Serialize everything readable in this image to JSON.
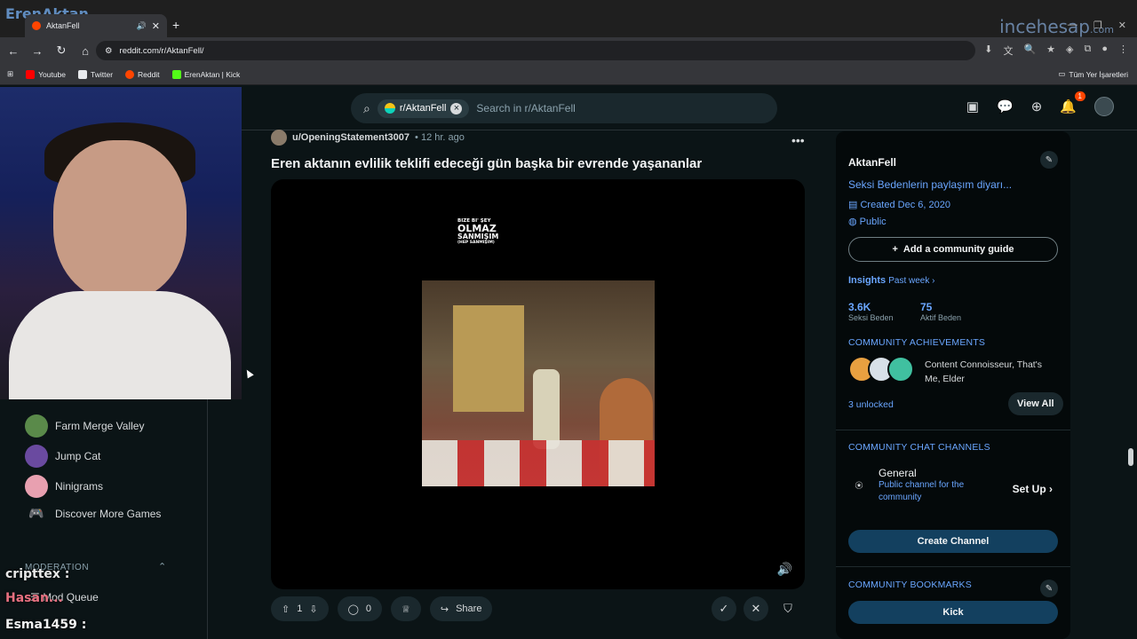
{
  "browser": {
    "tab_title": "AktanFell",
    "url": "reddit.com/r/AktanFell/",
    "brand_logo_text": "ErenAktan",
    "watermark": "incehesap",
    "watermark_suffix": ".com",
    "bookmarks": [
      {
        "label": "Youtube",
        "color": "#ff0000"
      },
      {
        "label": "Twitter",
        "color": "#e8eaed"
      },
      {
        "label": "Reddit",
        "color": "#ff4500"
      },
      {
        "label": "ErenAktan | Kick",
        "color": "#53fc18"
      }
    ],
    "bookmarks_folder": "Tüm Yer İşaretleri"
  },
  "header": {
    "subreddit_chip": "r/AktanFell",
    "search_placeholder": "Search in r/AktanFell",
    "notification_count": "1"
  },
  "left_sidebar": {
    "games": [
      {
        "label": "Farm Merge Valley",
        "color": "#5a8a4a"
      },
      {
        "label": "Jump Cat",
        "color": "#6a4aa0"
      },
      {
        "label": "Ninigrams",
        "color": "#e8a0b0"
      },
      {
        "label": "Discover More Games",
        "color": ""
      }
    ],
    "moderation_label": "MODERATION",
    "mod_queue": "Mod Queue"
  },
  "stream_chat": [
    {
      "text": "cripttex :"
    },
    {
      "text": "Hasan..."
    },
    {
      "text": "Esma1459 :"
    }
  ],
  "post": {
    "author": "u/OpeningStatement3007",
    "time": "12 hr. ago",
    "title": "Eren aktanın evlilik teklifi edeceği gün başka bir evrende yaşananlar",
    "video_caption": {
      "line1": "BIZE BI' ŞEY",
      "line2": "OLMAZ",
      "line3": "SANMIŞIM",
      "line4": "(HEP SANMIŞIM)"
    },
    "votes": "1",
    "comments": "0",
    "share_label": "Share"
  },
  "right_sidebar": {
    "community_name": "AktanFell",
    "description": "Seksi Bedenlerin paylaşım diyarı...",
    "created": "Created Dec 6, 2020",
    "visibility": "Public",
    "add_guide_label": "Add a community guide",
    "insights_label": "Insights",
    "insights_period": "Past week",
    "stats": [
      {
        "value": "3.6K",
        "label": "Seksi Beden"
      },
      {
        "value": "75",
        "label": "Aktif Beden"
      }
    ],
    "achievements_title": "COMMUNITY ACHIEVEMENTS",
    "achievements_text": "Content Connoisseur, That's Me, Elder",
    "achievements_unlocked": "3 unlocked",
    "view_all_label": "View All",
    "chat_title": "COMMUNITY CHAT CHANNELS",
    "channel_name": "General",
    "channel_desc": "Public channel for the community",
    "setup_label": "Set Up",
    "create_channel_label": "Create Channel",
    "bookmarks_title": "COMMUNITY BOOKMARKS",
    "bookmark_kick": "Kick"
  },
  "colors": {
    "accent_blue": "#6aa6ff",
    "reddit_orange": "#ff4500",
    "bg": "#0b1416"
  }
}
